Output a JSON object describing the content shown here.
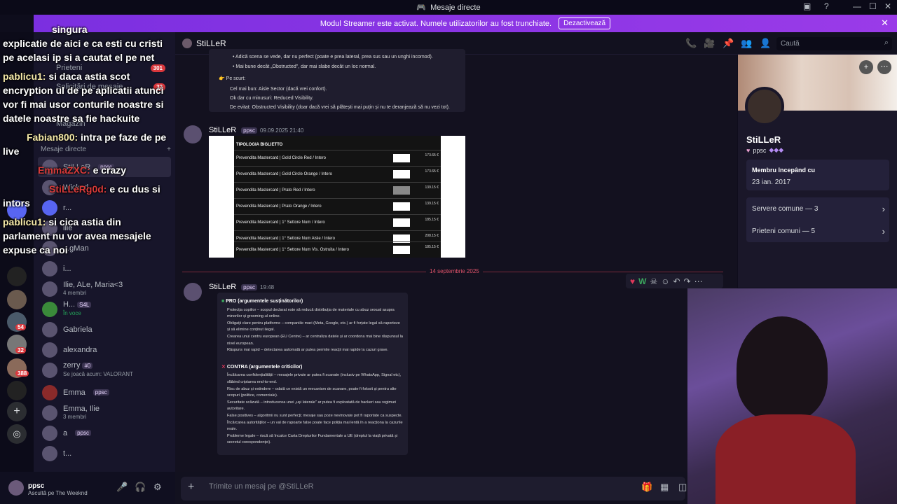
{
  "window": {
    "title": "Mesaje directe"
  },
  "banner": {
    "text": "Modul Streamer este activat. Numele utilizatorilor au fost trunchiate.",
    "button": "Dezactivează"
  },
  "rail": {
    "badges": [
      "54",
      "64",
      "32",
      "388"
    ]
  },
  "sidebar": {
    "nav": [
      {
        "label": "Prieteni",
        "count": "301"
      },
      {
        "label": "Solicitări de mesaje",
        "count": "32"
      },
      {
        "label": "Magazin",
        "count": ""
      }
    ],
    "dm_header": "Mesaje directe",
    "dms": [
      {
        "name": "StiLLeR",
        "tag": "ppsc",
        "sub": ""
      },
      {
        "name": "Wicked",
        "tag": "",
        "sub": ""
      },
      {
        "name": "r...",
        "tag": "",
        "sub": ""
      },
      {
        "name": "llie",
        "tag": "",
        "sub": ""
      },
      {
        "name": "...gMan",
        "tag": "",
        "sub": ""
      },
      {
        "name": "i...",
        "tag": "",
        "sub": ""
      },
      {
        "name": "Ilie, ALe, Maria<3",
        "tag": "",
        "sub": "4 membri"
      },
      {
        "name": "H...",
        "tag": "S4L",
        "sub": "În voce"
      },
      {
        "name": "Gabriela",
        "tag": "",
        "sub": ""
      },
      {
        "name": "alexandra",
        "tag": "",
        "sub": ""
      },
      {
        "name": "zerry",
        "tag": "#0",
        "sub": "Se joacă acum: VALORANT"
      },
      {
        "name": "Emma",
        "tag": "ppsc",
        "sub": ""
      },
      {
        "name": "Emma, Ilie",
        "tag": "",
        "sub": "3 membri"
      },
      {
        "name": "a",
        "tag": "ppsc",
        "sub": ""
      },
      {
        "name": "t...",
        "tag": "",
        "sub": ""
      }
    ]
  },
  "user": {
    "name": "ppsc",
    "status": "Ascultă pe The Weeknd"
  },
  "chat_header": {
    "name": "StiLLeR",
    "search_placeholder": "Caută"
  },
  "messages": {
    "top_card": {
      "line1": "• Adică scena se vede, dar nu perfect (poate e prea lateral, prea sus sau un unghi incomod).",
      "line2": "• Mai bune decât „Obstructed\", dar mai slabe decât un loc normal.",
      "title": "👉 Pe scurt:",
      "b1": "Cel mai bun: Aisle Sector (dacă vrei confort).",
      "b2": "Ok dar cu minusuri: Reduced Visibility.",
      "b3": "De evitat: Obstructed Visibility (doar dacă vrei să plătești mai puțin și nu te deranjează să nu vezi tot)."
    },
    "msg1": {
      "author": "StiLLeR",
      "tag": "ppsc",
      "time": "09.09.2025 21:40"
    },
    "ticket_table": {
      "header": "TIPOLOGIA BIGLIETTO",
      "rows": [
        {
          "label": "Prevendita Mastercard | Gold Circle  Red / Intero",
          "price": "173.65 €"
        },
        {
          "label": "Prevendita Mastercard | Gold Circle  Orange / Intero",
          "price": "173.65 €"
        },
        {
          "label": "Prevendita Mastercard | Prato Red / Intero",
          "price": "139.15 €"
        },
        {
          "label": "Prevendita Mastercard | Prato Orange / Intero",
          "price": "139.15 €"
        },
        {
          "label": "Prevendita Mastercard | 1° Settore Num / Intero",
          "price": "185.15 €"
        },
        {
          "label": "Prevendita Mastercard | 1° Settore Num Aisle / Intero",
          "price": "208.15 €"
        },
        {
          "label": "Prevendita Mastercard | 1° Settore Num Vis. Ostruita / Intero",
          "price": "185.15 €"
        }
      ]
    },
    "date_divider": "14 septembrie 2025",
    "msg2": {
      "author": "StiLLeR",
      "tag": "ppsc",
      "time": "19:48",
      "pro_title": "PRO (argumentele susținătorilor)",
      "pro": [
        "Protecția copiilor – scopul declarat este să reducă distribuția de materiale cu abuz sexual asupra minorilor și grooming-ul online.",
        "Obligații clare pentru platforme – companiile mari (Meta, Google, etc.) ar fi forțate legal să raporteze și să elimine conținut ilegal.",
        "Crearea unui centru european (EU Centre) – ar centraliza datele și ar coordona mai bine răspunsul la nivel european.",
        "Răspuns mai rapid – detectarea automată ar putea permite reacții mai rapide la cazuri grave."
      ],
      "contra_title": "CONTRA (argumentele criticilor)",
      "contra": [
        "Încălcarea confidențialității – mesajele private ar putea fi scanate (inclusiv pe WhatsApp, Signal etc), slăbind criptarea end-to-end.",
        "Risc de abuz și extindere – odată ce există un mecanism de scanare, poate fi folosit și pentru alte scopuri (politice, comerciale).",
        "Securitate scăzută – introducerea unei „uși laterale\" ar putea fi exploatată de hackeri sau regimuri autoritare.",
        "False positives – algoritmii nu sunt perfecți; mesaje sau poze nevinovate pot fi raportate ca suspecte.",
        "Încărcarea autorităților – un val de rapoarte false poate face poliția mai lentă în a reacționa la cazurile reale.",
        "Probleme legale – riscă să încalce Carta Drepturilor Fundamentale a UE (dreptul la viață privată și secretul corespondenței)."
      ]
    }
  },
  "composer": {
    "placeholder": "Trimite un mesaj pe @StiLLeR"
  },
  "profile": {
    "name": "StiLLeR",
    "tag": "ppsc",
    "member_since_label": "Membru începând cu",
    "member_since": "23 ian. 2017",
    "common_servers": "Servere comune — 3",
    "common_friends": "Prieteni comuni — 5"
  },
  "overlay_chat": [
    {
      "user": "",
      "text": "singura"
    },
    {
      "user": "",
      "text": "explicatie de aici e ca esti cu cristi"
    },
    {
      "user": "",
      "text": "pe acelasi ip si a cautat el pe net"
    },
    {
      "user": "pablicu1:",
      "text": "si daca astia scot"
    },
    {
      "user": "",
      "text": "encryption ul de pe aplicatii atunci"
    },
    {
      "user": "",
      "text": "vor fi mai usor conturile noastre si"
    },
    {
      "user": "",
      "text": "datele noastre sa fie hackuite"
    },
    {
      "user": "Fabian800:",
      "text": "intra pe faze de pe"
    },
    {
      "user": "",
      "text": "live"
    },
    {
      "user": "EmmaZXC:",
      "text": "e crazy"
    },
    {
      "user": "StiLLeRg0d:",
      "text": "e cu dus si"
    },
    {
      "user": "",
      "text": "intors"
    },
    {
      "user": "pablicu1:",
      "text": "si cica astia din"
    },
    {
      "user": "",
      "text": "parlament nu vor avea mesajele"
    },
    {
      "user": "",
      "text": "expuse ca noi"
    }
  ]
}
